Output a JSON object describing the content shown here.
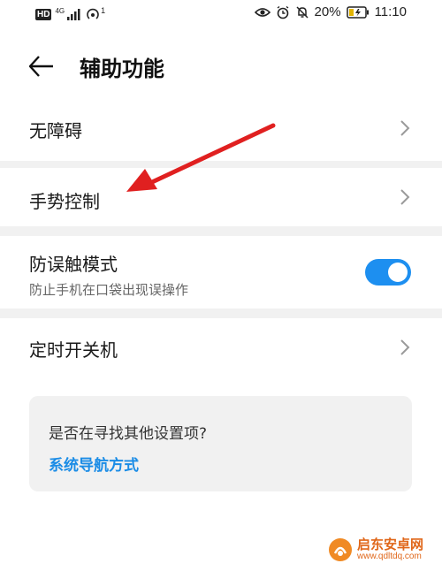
{
  "status_bar": {
    "hd": "HD",
    "network": "4G",
    "sim_index": "1",
    "battery_percent": "20%",
    "time": "11:10"
  },
  "header": {
    "title": "辅助功能"
  },
  "rows": [
    {
      "label": "无障碍"
    },
    {
      "label": "手势控制"
    },
    {
      "label": "防误触模式",
      "subtitle": "防止手机在口袋出现误操作",
      "toggle_on": true
    },
    {
      "label": "定时开关机"
    }
  ],
  "suggestion_card": {
    "question": "是否在寻找其他设置项?",
    "link": "系统导航方式"
  },
  "watermark": {
    "title": "启东安卓网",
    "url": "www.qdltdq.com"
  },
  "colors": {
    "accent": "#1d8ff0",
    "link": "#1a8ce6",
    "annotation": "#e02020",
    "divider": "#f1f1f1"
  },
  "icons": [
    "eye-comfort-icon",
    "alarm-icon",
    "mute-icon",
    "battery-icon",
    "wifi-hotspot-icon",
    "signal-icon",
    "back-arrow-icon",
    "chevron-right-icon"
  ]
}
